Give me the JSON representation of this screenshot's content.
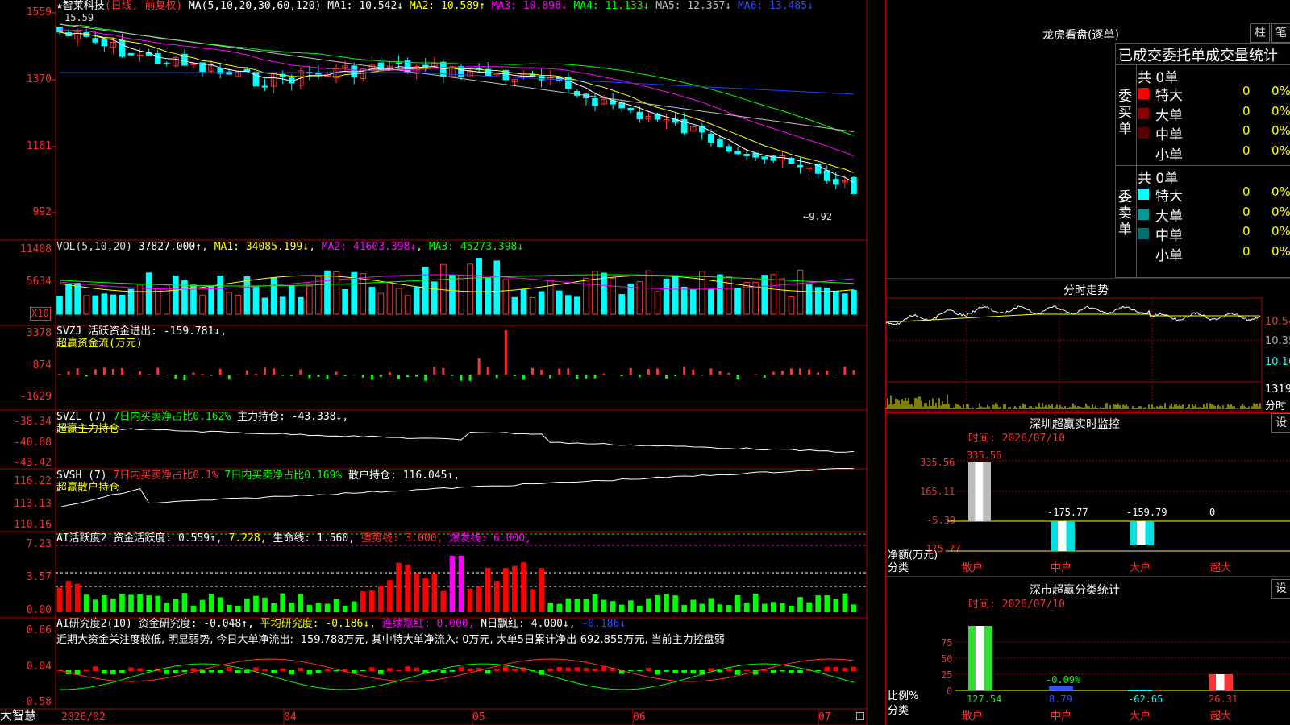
{
  "colors": {
    "up": "#ff3232",
    "down": "#00ffff",
    "ma1": "#ffffff",
    "ma2": "#ffff00",
    "ma3": "#ff00ff",
    "ma4": "#00ff00",
    "ma5": "#c0c0c0",
    "ma6": "#1f3cff",
    "grid": "#b00000"
  },
  "price_header": {
    "star": "★",
    "name": "智莱科技",
    "period": "(日线, 前复权)",
    "ma_label": "MA(5,10,20,30,60,120)",
    "ma1": "MA1: 10.542↓",
    "ma2": "MA2: 10.589↑",
    "ma3": "MA3: 10.898↓",
    "ma4": "MA4: 11.133↓",
    "ma5": "MA5: 12.357↓",
    "ma6": "MA6: 13.485↓",
    "hi_label": "15.59",
    "lo_label": "←9.92"
  },
  "price_axis": [
    "1559",
    "1370",
    "1181",
    "992"
  ],
  "vol_header": {
    "label": "VOL(5,10,20)",
    "v": "37827.000↑",
    "ma1": "MA1: 34085.199↓",
    "ma2": "MA2: 41603.398↓",
    "ma3": "MA3: 45273.398↓"
  },
  "vol_axis": [
    "11408",
    "5634"
  ],
  "vol_unit": "X10",
  "svzj_header": {
    "label": "SVZJ  活跃资金进出: -159.781↓,",
    "sub": "超赢资金流(万元)"
  },
  "svzj_axis": [
    "3378",
    "874",
    "-1629"
  ],
  "svzl_header": {
    "label": "SVZL (7)",
    "a": "7日内买卖净占比0.162%",
    "b": "主力持仓: -43.338↓,",
    "sub": "超赢主力持仓"
  },
  "svzl_axis": [
    "-38.34",
    "-40.88",
    "-43.42"
  ],
  "svsh_header": {
    "label": "SVSH (7)",
    "a": "7日内买卖净占比0.1%",
    "b": "7日内买卖净占比0.169%",
    "c": "散户持仓: 116.045↑,",
    "sub": "超赢散户持仓"
  },
  "svsh_axis": [
    "116.22",
    "113.13",
    "110.16"
  ],
  "ai1_header": {
    "label": "AI活跃度2",
    "a": "资金活跃度: 0.559↑,",
    "b": "7.228,",
    "c": "生命线: 1.560,",
    "d": "强势线: 3.000,",
    "e": "爆发线: 6.000,"
  },
  "ai1_axis": [
    "7.23",
    "3.57",
    "0.00"
  ],
  "ai2_header": {
    "label": "AI研究度2(10)",
    "a": "资金研究度: -0.048↑,",
    "b": "平均研究度: -0.186↓,",
    "c": "连续飘红: 0.000,",
    "d": "N日飘红: 4.000↓,",
    "e": "-0.186↓"
  },
  "ai2_comment": "近期大资金关注度较低, 明显弱势, 今日大单净流出: -159.788万元, 其中特大单净流入: 0万元, 大单5日累计净出-692.855万元, 当前主力控盘弱",
  "ai2_axis": [
    "0.66",
    "0.04",
    "-0.58"
  ],
  "date_axis": {
    "brand": "大智慧",
    "labels": [
      "2026/02",
      "04",
      "05",
      "06",
      "07"
    ]
  },
  "dragon": {
    "title": "龙虎看盘(逐单)",
    "btn_zhu": "柱",
    "btn_bi": "笔",
    "heading": "已成交委托单成交量统计",
    "buy": {
      "side": "委买单",
      "total": "共 0单",
      "rows": [
        {
          "label": "特大",
          "count": "0",
          "pct": "0%",
          "color": "#ff0000"
        },
        {
          "label": "大单",
          "count": "0",
          "pct": "0%",
          "color": "#8b0000"
        },
        {
          "label": "中单",
          "count": "0",
          "pct": "0%",
          "color": "#5a0000"
        },
        {
          "label": "小单",
          "count": "0",
          "pct": "0%",
          "color": "#000000"
        }
      ]
    },
    "sell": {
      "side": "委卖单",
      "total": "共 0单",
      "rows": [
        {
          "label": "特大",
          "count": "0",
          "pct": "0%",
          "color": "#00ffff"
        },
        {
          "label": "大单",
          "count": "0",
          "pct": "0%",
          "color": "#009a9a"
        },
        {
          "label": "中单",
          "count": "0",
          "pct": "0%",
          "color": "#007070"
        },
        {
          "label": "小单",
          "count": "0",
          "pct": "0%",
          "color": "#000000"
        }
      ]
    }
  },
  "intraday": {
    "title": "分时走势",
    "axis": [
      "10.54",
      "10.35",
      "10.16"
    ],
    "vol_axis": "1319",
    "vol_unit": "分时"
  },
  "monitor": {
    "title": "深圳超赢实时监控",
    "btn": "设",
    "time": "时间: 2026/07/10",
    "axis": [
      "335.56",
      "165.11",
      "-5.39",
      "-175.77"
    ],
    "unit": "净额(万元)",
    "cat_label": "分类",
    "cats": [
      "散户",
      "中户",
      "大户",
      "超大"
    ],
    "vals": [
      "335.56",
      "-175.77",
      "-159.79",
      "0"
    ]
  },
  "stats": {
    "title": "深市超赢分类统计",
    "btn": "设",
    "time": "时间: 2026/07/10",
    "axis": [
      "75",
      "50",
      "25",
      "0"
    ],
    "unit": "比例%",
    "cat_label": "分类",
    "cats": [
      "散户",
      "中户",
      "大户",
      "超大"
    ],
    "vals": [
      "127.54",
      "8.79",
      "-62.65",
      "26.31"
    ],
    "note": "-0.09%"
  }
}
